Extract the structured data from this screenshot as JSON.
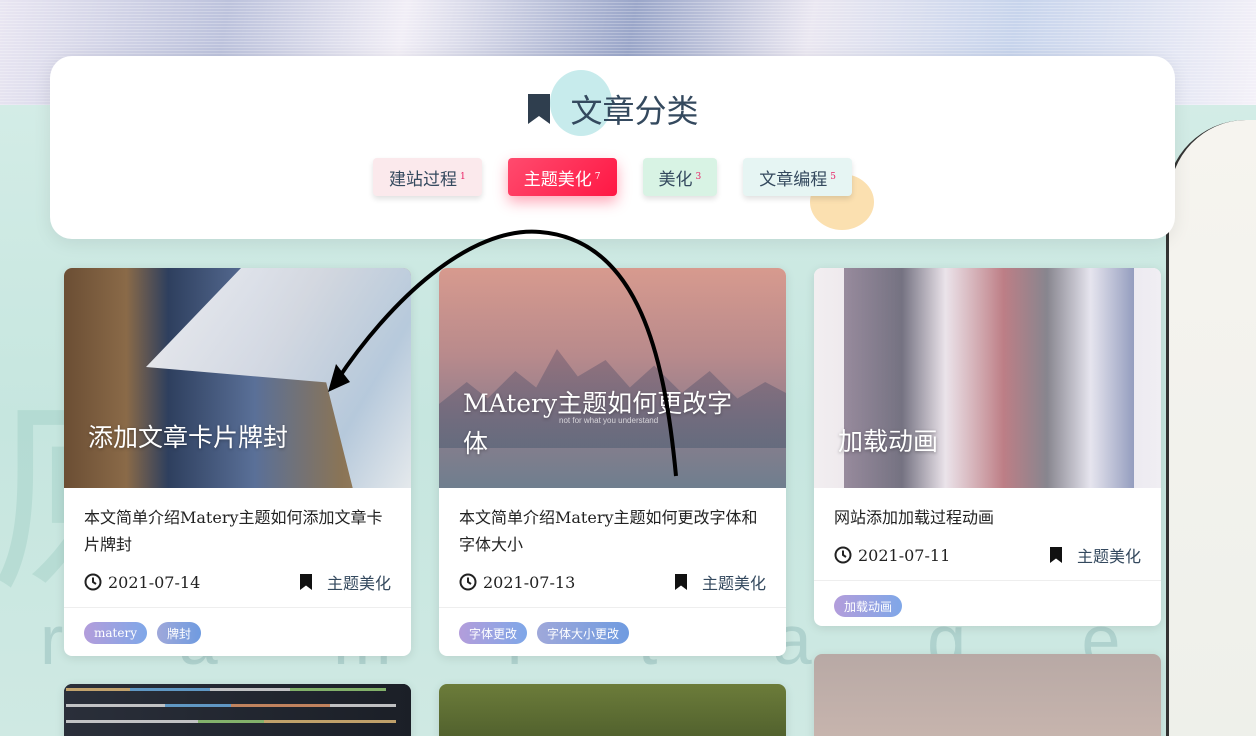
{
  "categories_panel": {
    "title": "文章分类",
    "items": [
      {
        "label": "建站过程",
        "count": "1",
        "bg": "#fbe9ec"
      },
      {
        "label": "主题美化",
        "count": "7",
        "active": true
      },
      {
        "label": "美化",
        "count": "3",
        "bg": "#d8f3e4"
      },
      {
        "label": "文章编程",
        "count": "5",
        "bg": "#e6f5f3"
      }
    ]
  },
  "cards": [
    {
      "image_title": "添加文章卡片牌封",
      "summary": "本文简单介绍Matery主题如何添加文章卡片牌封",
      "date": "2021-07-14",
      "category": "主题美化",
      "tags": [
        "matery",
        "牌封"
      ]
    },
    {
      "image_title": "MAtery主题如何更改字体",
      "summary": "本文简单介绍Matery主题如何更改字体和字体大小",
      "date": "2021-07-13",
      "category": "主题美化",
      "tags": [
        "字体更改",
        "字体大小更改"
      ]
    },
    {
      "image_title": "加载动画",
      "summary": "网站添加加载过程动画",
      "date": "2021-07-11",
      "category": "主题美化",
      "tags": [
        "加载动画"
      ]
    }
  ],
  "card_image_caption": "not for what you understand",
  "background": {
    "watermark_text": "原",
    "watermark_latin": "r a   m i t a g e"
  },
  "colors": {
    "accent": "#ff1744",
    "text_dark": "#34495e"
  }
}
